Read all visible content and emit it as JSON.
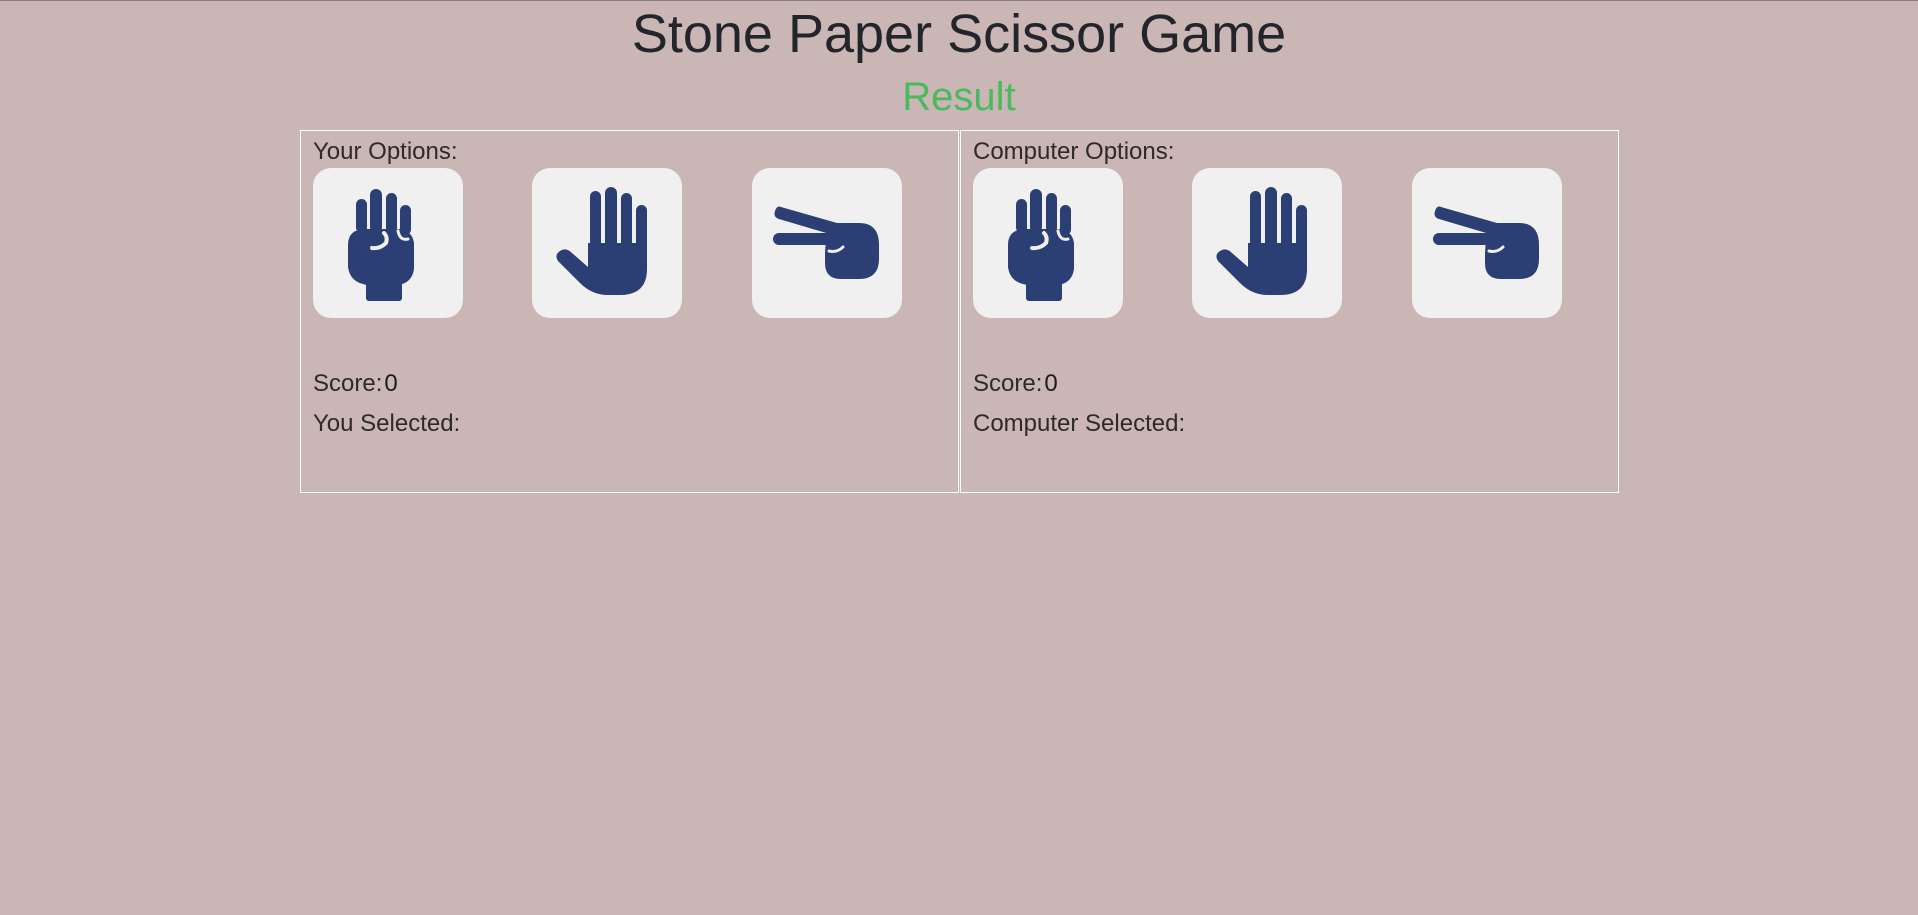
{
  "game": {
    "title": "Stone Paper Scissor Game",
    "result_label": "Result"
  },
  "player": {
    "options_label": "Your Options:",
    "options": [
      {
        "name": "stone",
        "icon": "fist-icon"
      },
      {
        "name": "paper",
        "icon": "open-hand-icon"
      },
      {
        "name": "scissor",
        "icon": "scissors-hand-icon"
      }
    ],
    "score_label": "Score:",
    "score": "0",
    "selected_label": "You Selected:",
    "selected_value": ""
  },
  "computer": {
    "options_label": "Computer Options:",
    "options": [
      {
        "name": "stone",
        "icon": "fist-icon"
      },
      {
        "name": "paper",
        "icon": "open-hand-icon"
      },
      {
        "name": "scissor",
        "icon": "scissors-hand-icon"
      }
    ],
    "score_label": "Score:",
    "score": "0",
    "selected_label": "Computer Selected:",
    "selected_value": ""
  },
  "colors": {
    "background": "#cab6b4",
    "title": "#23252a",
    "result": "#4bb95f",
    "icon": "#2c3f75",
    "tile": "#f0f0f0",
    "panel_border": "#ffffff"
  }
}
